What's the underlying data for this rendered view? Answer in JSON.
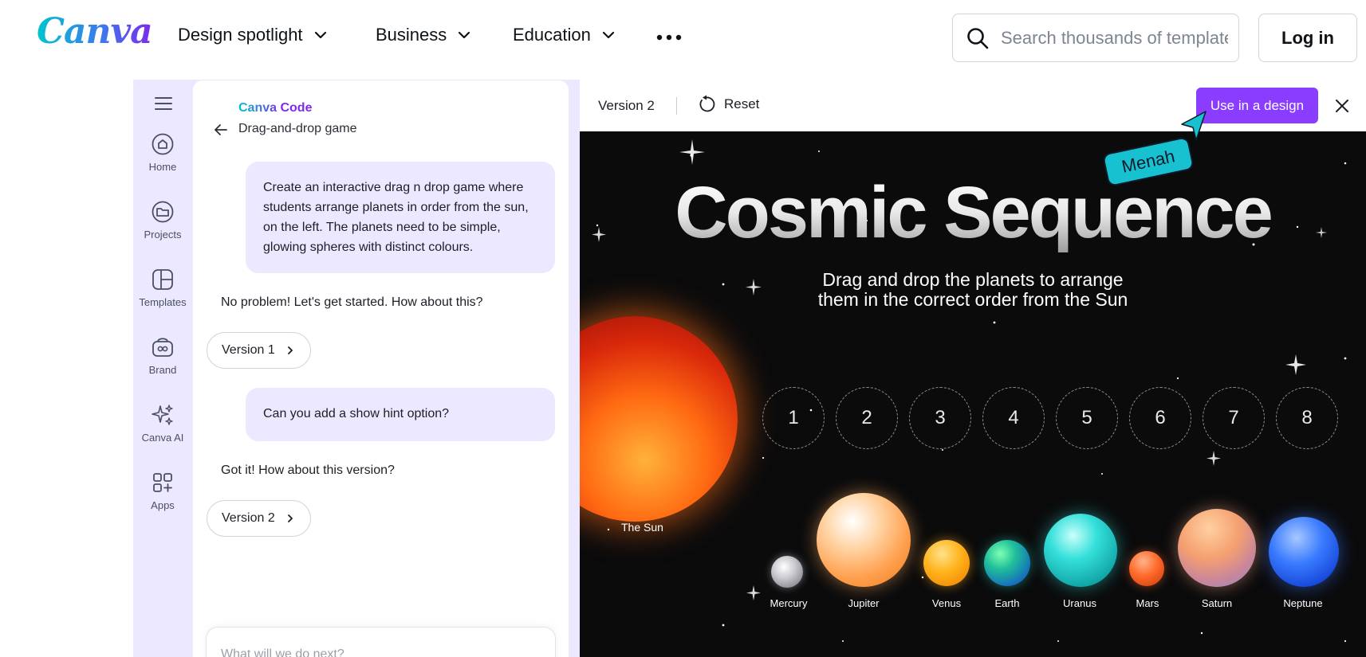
{
  "topnav": {
    "logo": "Canva",
    "menu": [
      {
        "label": "Design spotlight"
      },
      {
        "label": "Business"
      },
      {
        "label": "Education"
      }
    ],
    "search_placeholder": "Search thousands of templates",
    "login_label": "Log in"
  },
  "rail": {
    "items": [
      {
        "label": "Home",
        "icon": "home-icon"
      },
      {
        "label": "Projects",
        "icon": "folder-icon"
      },
      {
        "label": "Templates",
        "icon": "templates-icon"
      },
      {
        "label": "Brand",
        "icon": "brand-icon"
      },
      {
        "label": "Canva AI",
        "icon": "sparkle-icon"
      },
      {
        "label": "Apps",
        "icon": "apps-icon"
      }
    ]
  },
  "chat": {
    "title": "Canva Code",
    "subtitle": "Drag-and-drop game",
    "messages": [
      {
        "role": "user",
        "text": "Create an interactive drag n drop game where students arrange planets in order from the sun, on the left. The planets need to be simple, glowing spheres with distinct colours."
      },
      {
        "role": "assistant",
        "text": "No problem! Let's get started. How about this?"
      },
      {
        "role": "version",
        "text": "Version 1"
      },
      {
        "role": "user",
        "text": "Can you add a show hint option?"
      },
      {
        "role": "assistant",
        "text": "Got it! How about this version?"
      },
      {
        "role": "version",
        "text": "Version 2"
      }
    ],
    "prompt_placeholder": "What will we do next?"
  },
  "preview": {
    "version_label": "Version 2",
    "reset_label": "Reset",
    "use_label": "Use in a design",
    "collaborator_tag": "Menah"
  },
  "game": {
    "title": "Cosmic Sequence",
    "subtitle_line1": "Drag and drop the planets to arrange",
    "subtitle_line2": "them in the correct order from the Sun",
    "sun_label": "The Sun",
    "slots": [
      "1",
      "2",
      "3",
      "4",
      "5",
      "6",
      "7",
      "8"
    ],
    "planets": [
      {
        "name": "Mercury"
      },
      {
        "name": "Jupiter"
      },
      {
        "name": "Venus"
      },
      {
        "name": "Earth"
      },
      {
        "name": "Uranus"
      },
      {
        "name": "Mars"
      },
      {
        "name": "Saturn"
      },
      {
        "name": "Neptune"
      }
    ]
  },
  "colors": {
    "brand_purple": "#8b3dff",
    "brand_teal": "#00c4cc",
    "panel_lavender": "#ece8ff",
    "stage_bg": "#0b0b0c"
  }
}
